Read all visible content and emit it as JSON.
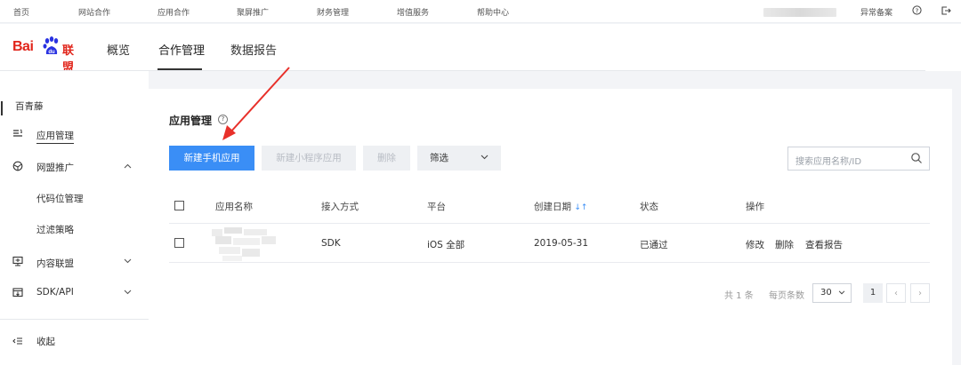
{
  "topbar": {
    "items": [
      "首页",
      "网站合作",
      "应用合作",
      "聚屏推广",
      "财务管理",
      "增值服务",
      "帮助中心"
    ],
    "abnormal_filing": "异常备案"
  },
  "header": {
    "logo_text": "Bai",
    "logo_suffix": "联盟",
    "tabs": [
      "概览",
      "合作管理",
      "数据报告"
    ],
    "active_tab": "合作管理"
  },
  "sidebar": {
    "account": "百青藤",
    "items": [
      {
        "label": "应用管理",
        "icon": "list-icon",
        "active": true
      },
      {
        "label": "网盟推广",
        "icon": "globe-icon",
        "expanded": true
      },
      {
        "label": "代码位管理",
        "sub": true
      },
      {
        "label": "过滤策略",
        "sub": true
      },
      {
        "label": "内容联盟",
        "icon": "monitor-icon",
        "expanded": false
      },
      {
        "label": "SDK/API",
        "icon": "box-icon",
        "expanded": false
      }
    ],
    "collapse": "收起"
  },
  "main": {
    "title": "应用管理",
    "buttons": {
      "new_mobile_app": "新建手机应用",
      "new_mini_program": "新建小程序应用",
      "delete": "删除",
      "filter": "筛选"
    },
    "search_placeholder": "搜索应用名称/ID",
    "columns": [
      "应用名称",
      "接入方式",
      "平台",
      "创建日期",
      "状态",
      "操作"
    ],
    "rows": [
      {
        "name": "",
        "access": "SDK",
        "platform": "iOS 全部",
        "created": "2019-05-31",
        "status": "已通过",
        "ops": [
          "修改",
          "删除",
          "查看报告"
        ]
      }
    ],
    "pagination": {
      "total": "共 1 条",
      "per_page_label": "每页条数",
      "per_page": "30",
      "current_page": "1"
    }
  },
  "colors": {
    "primary": "#3a8ef6",
    "brand_red": "#e1251b",
    "annotation_red": "#e8302a"
  }
}
